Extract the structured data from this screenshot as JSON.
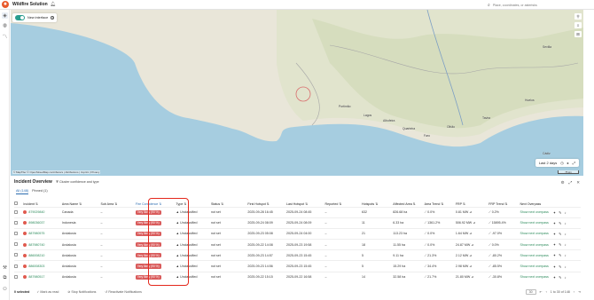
{
  "app": {
    "title": "Wildfire Solution"
  },
  "search": {
    "placeholder": "Place, coordinates, or asterisks"
  },
  "map": {
    "toggle_label": "New interface",
    "time_filter": "Last 2 days",
    "scale": "75 km",
    "attribution": "© MapTiler © OpenStreetMap contributors | Attributions | Imprint | Privacy",
    "places": [
      "Portimão",
      "Faro",
      "Lagos",
      "Olhão",
      "Tavira",
      "Quarteira",
      "Albufeira",
      "Huelva",
      "Cádiz",
      "Sevilla"
    ]
  },
  "panel": {
    "title": "Incident Overview",
    "cluster_label": "Cluster confidence and type",
    "tabs": [
      "All (148)",
      "Pinned (1)"
    ]
  },
  "columns": [
    "Incident",
    "Area Name",
    "Sub Area",
    "Fire Confidence",
    "Type",
    "Status",
    "First Hotspot",
    "Last Hotspot",
    "Reported",
    "Hotspots",
    "Affected Area",
    "Area Trend",
    "FRP",
    "FRP Trend",
    "Next Overpass"
  ],
  "rows": [
    {
      "id": "879029840",
      "area": "Canada",
      "sub": "–",
      "conf": "Very likely (90 %)",
      "type": "Unclassified",
      "status": "not set",
      "first": "2025-09-28 16:45",
      "last": "2025-09-24 08:45",
      "reported": "–",
      "hotspots": "632",
      "affected": "826.68 ha",
      "area_trend": "0.0%",
      "frp": "0.81 MW",
      "frp_trend": "0.2%",
      "next": "Show next overpass"
    },
    {
      "id": "898036037",
      "area": "Indonesia",
      "sub": "–",
      "conf": "Very likely (90 %)",
      "type": "Unclassified",
      "status": "not set",
      "first": "2025-09-24 08:09",
      "last": "2025-09-24 08:09",
      "reported": "–",
      "hotspots": "11",
      "affected": "6.33 ha",
      "area_trend": "1361.2%",
      "frp": "506.92 MW",
      "frp_trend": "15895.4%",
      "next": "Show next overpass"
    },
    {
      "id": "887980575",
      "area": "Andalusia",
      "sub": "–",
      "conf": "Very likely (90 %)",
      "type": "Unclassified",
      "status": "not set",
      "first": "2025-09-23 05:08",
      "last": "2025-09-24 04:00",
      "reported": "–",
      "hotspots": "21",
      "affected": "113.23 ha",
      "area_trend": "0.0%",
      "frp": "1.64 MW",
      "frp_trend": "-97.0%",
      "next": "Show next overpass"
    },
    {
      "id": "887980740",
      "area": "Andalusia",
      "sub": "–",
      "conf": "Very likely (90 %)",
      "type": "Unclassified",
      "status": "not set",
      "first": "2025-09-22 14:08",
      "last": "2025-09-23 19:58",
      "reported": "–",
      "hotspots": "18",
      "affected": "11.55 ha",
      "area_trend": "0.0%",
      "frp": "24.87 MW",
      "frp_trend": "0.0%",
      "next": "Show next overpass"
    },
    {
      "id": "886008210",
      "area": "Andalusia",
      "sub": "–",
      "conf": "Very likely (90 %)",
      "type": "Unclassified",
      "status": "not set",
      "first": "2025-09-23 14:57",
      "last": "2025-09-23 15:45",
      "reported": "–",
      "hotspots": "5",
      "affected": "9.11 ha",
      "area_trend": "21.3%",
      "frp": "2.12 MW",
      "frp_trend": "-80.2%",
      "next": "Show next overpass"
    },
    {
      "id": "886008303",
      "area": "Andalusia",
      "sub": "–",
      "conf": "Very likely (90 %)",
      "type": "Unclassified",
      "status": "not set",
      "first": "2025-09-23 14:56",
      "last": "2025-09-23 15:45",
      "reported": "–",
      "hotspots": "5",
      "affected": "15.29 ha",
      "area_trend": "34.4%",
      "frp": "2.98 MW",
      "frp_trend": "-85.5%",
      "next": "Show next overpass"
    },
    {
      "id": "887980517",
      "area": "Andalusia",
      "sub": "–",
      "conf": "Very likely (90 %)",
      "type": "Unclassified",
      "status": "not set",
      "first": "2025-09-22 15:15",
      "last": "2025-09-22 16:58",
      "reported": "–",
      "hotspots": "14",
      "affected": "32.58 ha",
      "area_trend": "21.7%",
      "frp": "21.80 MW",
      "frp_trend": "-30.8%",
      "next": "Show next overpass"
    }
  ],
  "footer": {
    "selected": "0 selected",
    "mark_read": "Mark as read",
    "stop_notifications": "Stop Notifications",
    "reactivate": "Reactivate Notifications",
    "page_size": "30",
    "page_info": "1 to 30 of 148"
  },
  "colors": {
    "accent": "#2b6cb0",
    "badge": "#d95b5b",
    "highlight": "#e4281c",
    "map_water": "#a6cde0"
  }
}
